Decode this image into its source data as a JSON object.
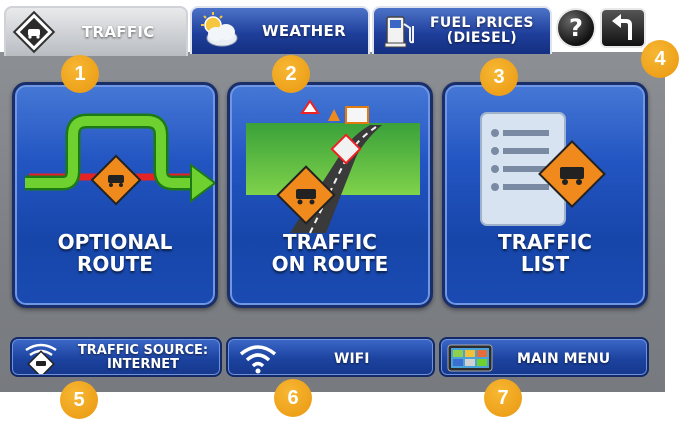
{
  "tabs": [
    {
      "label": "TRAFFIC",
      "icon": "traffic-diamond-icon",
      "active": true
    },
    {
      "label": "WEATHER",
      "icon": "weather-cloud-icon",
      "active": false
    },
    {
      "label_line1": "FUEL PRICES",
      "label_line2": "(DIESEL)",
      "icon": "fuel-pump-icon",
      "active": false
    }
  ],
  "toolbar": {
    "help_label": "?",
    "help_icon": "help-icon",
    "back_icon": "back-arrow-icon"
  },
  "tiles": [
    {
      "line1": "OPTIONAL",
      "line2": "ROUTE",
      "icon": "optional-route-icon"
    },
    {
      "line1": "TRAFFIC",
      "line2": "ON ROUTE",
      "icon": "traffic-on-route-icon"
    },
    {
      "line1": "TRAFFIC",
      "line2": "LIST",
      "icon": "traffic-list-icon"
    }
  ],
  "bottom": {
    "source_line1": "TRAFFIC SOURCE:",
    "source_line2": "INTERNET",
    "wifi_label": "WIFI",
    "menu_label": "MAIN MENU"
  },
  "callouts": [
    "1",
    "2",
    "3",
    "4",
    "5",
    "6",
    "7"
  ],
  "colors": {
    "button_blue": "#1f4fb5",
    "callout_orange": "#eea11a",
    "panel_grey": "#85888d",
    "warning_orange": "#f08a1c"
  }
}
